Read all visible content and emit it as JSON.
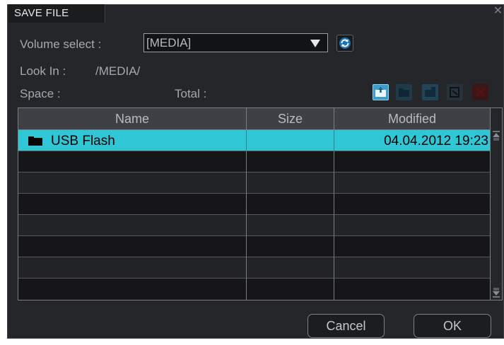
{
  "dialog": {
    "title": "SAVE FILE",
    "close_icon": "close-icon"
  },
  "volume": {
    "label": "Volume select :",
    "value": "[MEDIA]"
  },
  "look_in": {
    "label": "Look In :",
    "path": "/MEDIA/"
  },
  "space": {
    "label": "Space :",
    "total_label": "Total :"
  },
  "toolbar": {
    "icons": [
      "folder-up-icon",
      "new-folder-icon",
      "rename-folder-icon",
      "select-icon",
      "delete-icon"
    ]
  },
  "table": {
    "headers": {
      "name": "Name",
      "size": "Size",
      "modified": "Modified"
    },
    "rows": [
      {
        "name": "USB Flash",
        "size": "",
        "modified": "04.04.2012 19:23"
      }
    ]
  },
  "buttons": {
    "cancel": "Cancel",
    "ok": "OK"
  },
  "colors": {
    "selection": "#2fc7d6",
    "background": "#242629",
    "header": "#3e4045"
  }
}
